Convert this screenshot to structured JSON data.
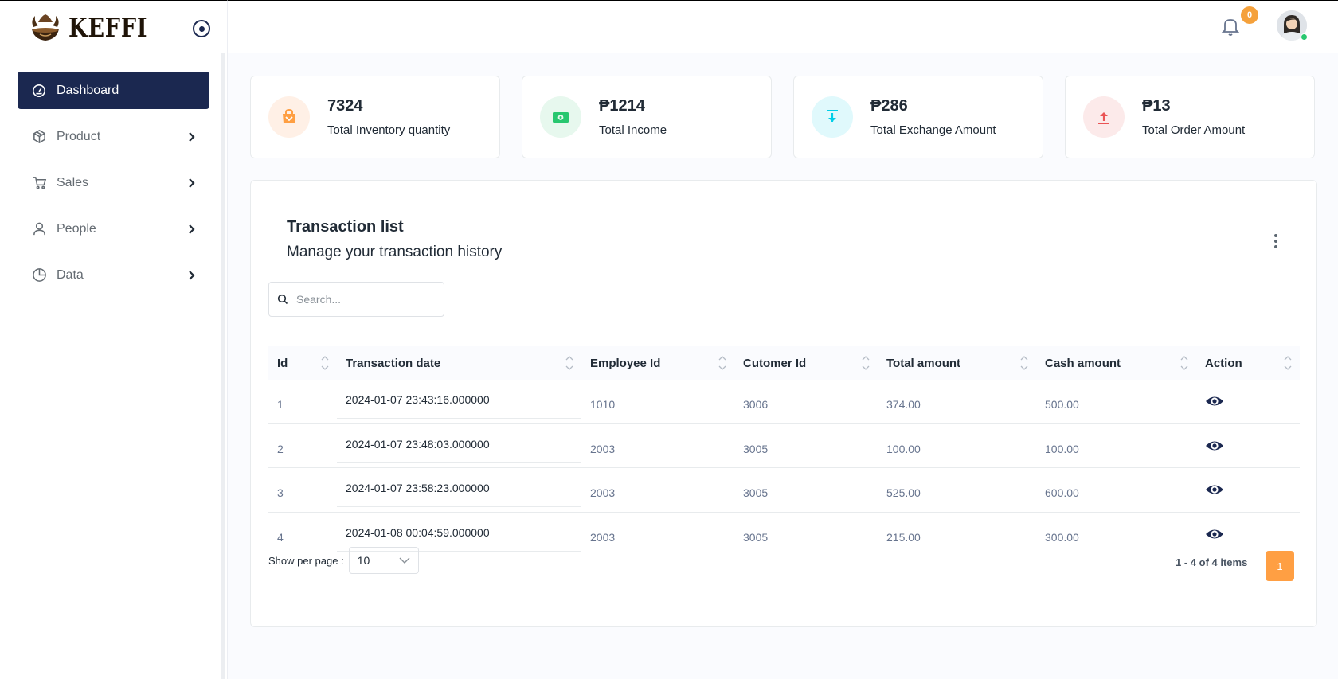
{
  "brand": {
    "name": "KEFFI"
  },
  "sidebar": {
    "items": [
      {
        "label": "Dashboard",
        "icon": "dashboard-gauge-icon",
        "active": true
      },
      {
        "label": "Product",
        "icon": "box-icon"
      },
      {
        "label": "Sales",
        "icon": "cart-icon"
      },
      {
        "label": "People",
        "icon": "user-icon"
      },
      {
        "label": "Data",
        "icon": "pie-chart-icon"
      }
    ]
  },
  "header": {
    "notification_count": "0"
  },
  "stats": [
    {
      "value": "7324",
      "label": "Total Inventory quantity",
      "color": "#ff9f43",
      "bg": "#fff0e6"
    },
    {
      "value": "₱1214",
      "label": "Total Income",
      "color": "#28c76f",
      "bg": "#e7f8ee"
    },
    {
      "value": "₱286",
      "label": "Total Exchange Amount",
      "color": "#00cfe8",
      "bg": "#e0f9fc"
    },
    {
      "value": "₱13",
      "label": "Total Order Amount",
      "color": "#ea5455",
      "bg": "#fceaea"
    }
  ],
  "transactions": {
    "title": "Transaction list",
    "subtitle": "Manage your transaction history",
    "search_placeholder": "Search...",
    "columns": [
      "Id",
      "Transaction date",
      "Employee Id",
      "Cutomer Id",
      "Total amount",
      "Cash amount",
      "Action"
    ],
    "rows": [
      {
        "id": "1",
        "date": "2024-01-07 23:43:16.000000",
        "employee": "1010",
        "customer": "3006",
        "total": "374.00",
        "cash": "500.00"
      },
      {
        "id": "2",
        "date": "2024-01-07 23:48:03.000000",
        "employee": "2003",
        "customer": "3005",
        "total": "100.00",
        "cash": "100.00"
      },
      {
        "id": "3",
        "date": "2024-01-07 23:58:23.000000",
        "employee": "2003",
        "customer": "3005",
        "total": "525.00",
        "cash": "600.00"
      },
      {
        "id": "4",
        "date": "2024-01-08 00:04:59.000000",
        "employee": "2003",
        "customer": "3005",
        "total": "215.00",
        "cash": "300.00"
      }
    ],
    "show_per_page_label": "Show per page :",
    "per_page": "10",
    "pagination_info": "1 - 4 of 4 items",
    "current_page": "1"
  },
  "colors": {
    "primary": "#1b2850",
    "accent": "#ff9f43"
  }
}
